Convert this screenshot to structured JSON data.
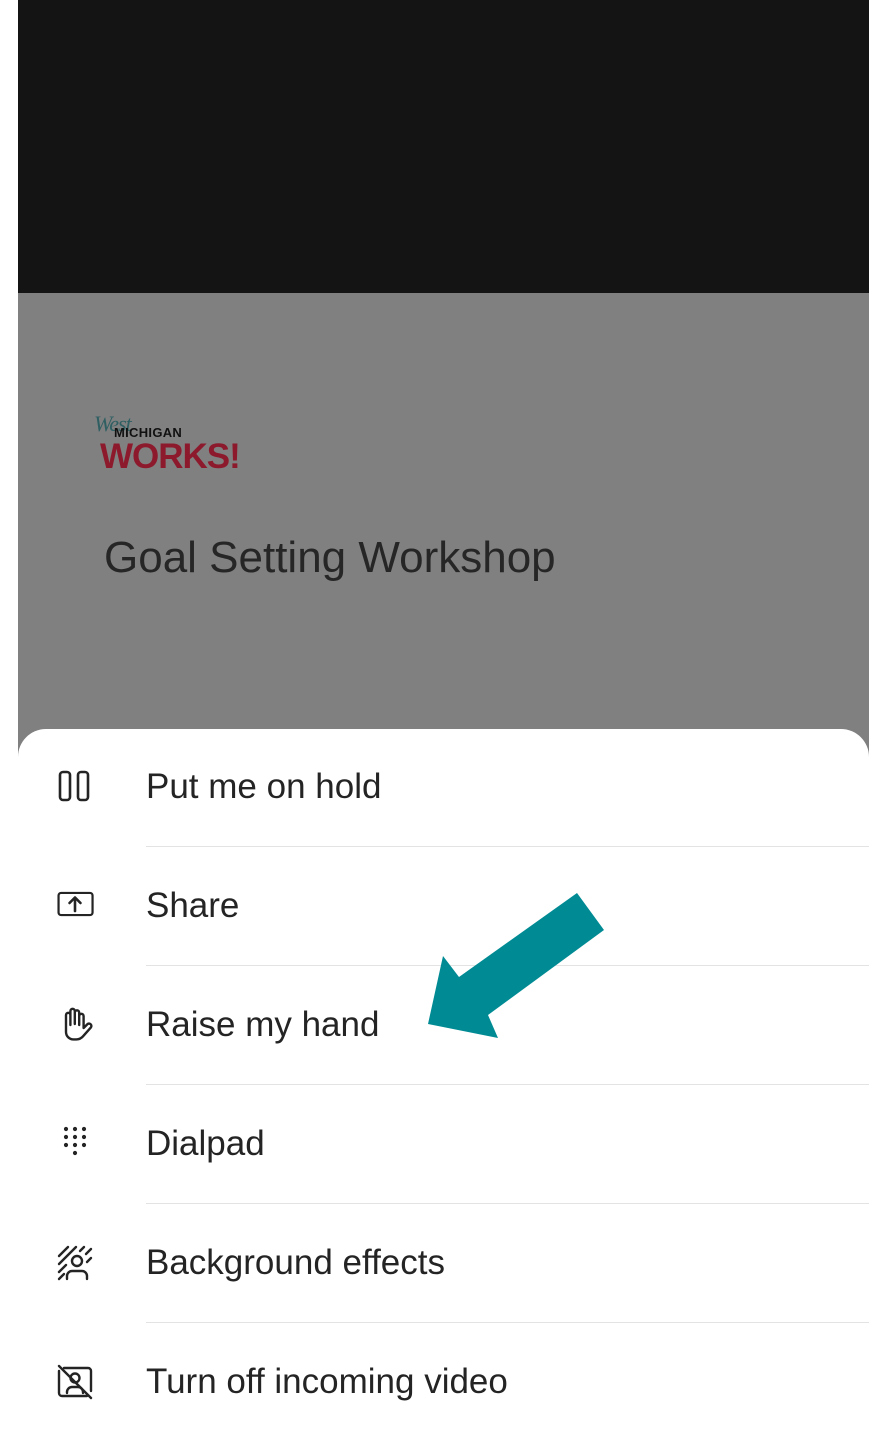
{
  "meeting": {
    "logo_west": "West",
    "logo_michigan": "MICHIGAN",
    "logo_works": "WORKS!",
    "title": "Goal Setting Workshop"
  },
  "menu": {
    "items": [
      {
        "label": "Put me on hold",
        "icon": "pause-icon"
      },
      {
        "label": "Share",
        "icon": "share-upload-icon"
      },
      {
        "label": "Raise my hand",
        "icon": "raise-hand-icon"
      },
      {
        "label": "Dialpad",
        "icon": "dialpad-icon"
      },
      {
        "label": "Background effects",
        "icon": "background-effects-icon"
      },
      {
        "label": "Turn off incoming video",
        "icon": "video-off-icon"
      }
    ]
  },
  "annotation": {
    "arrow_color": "#008b94",
    "arrow_target": "Raise my hand"
  },
  "colors": {
    "top_bar": "#141414",
    "meeting_bg": "#808080",
    "sheet_bg": "#ffffff",
    "logo_red": "#8c1a2c"
  }
}
